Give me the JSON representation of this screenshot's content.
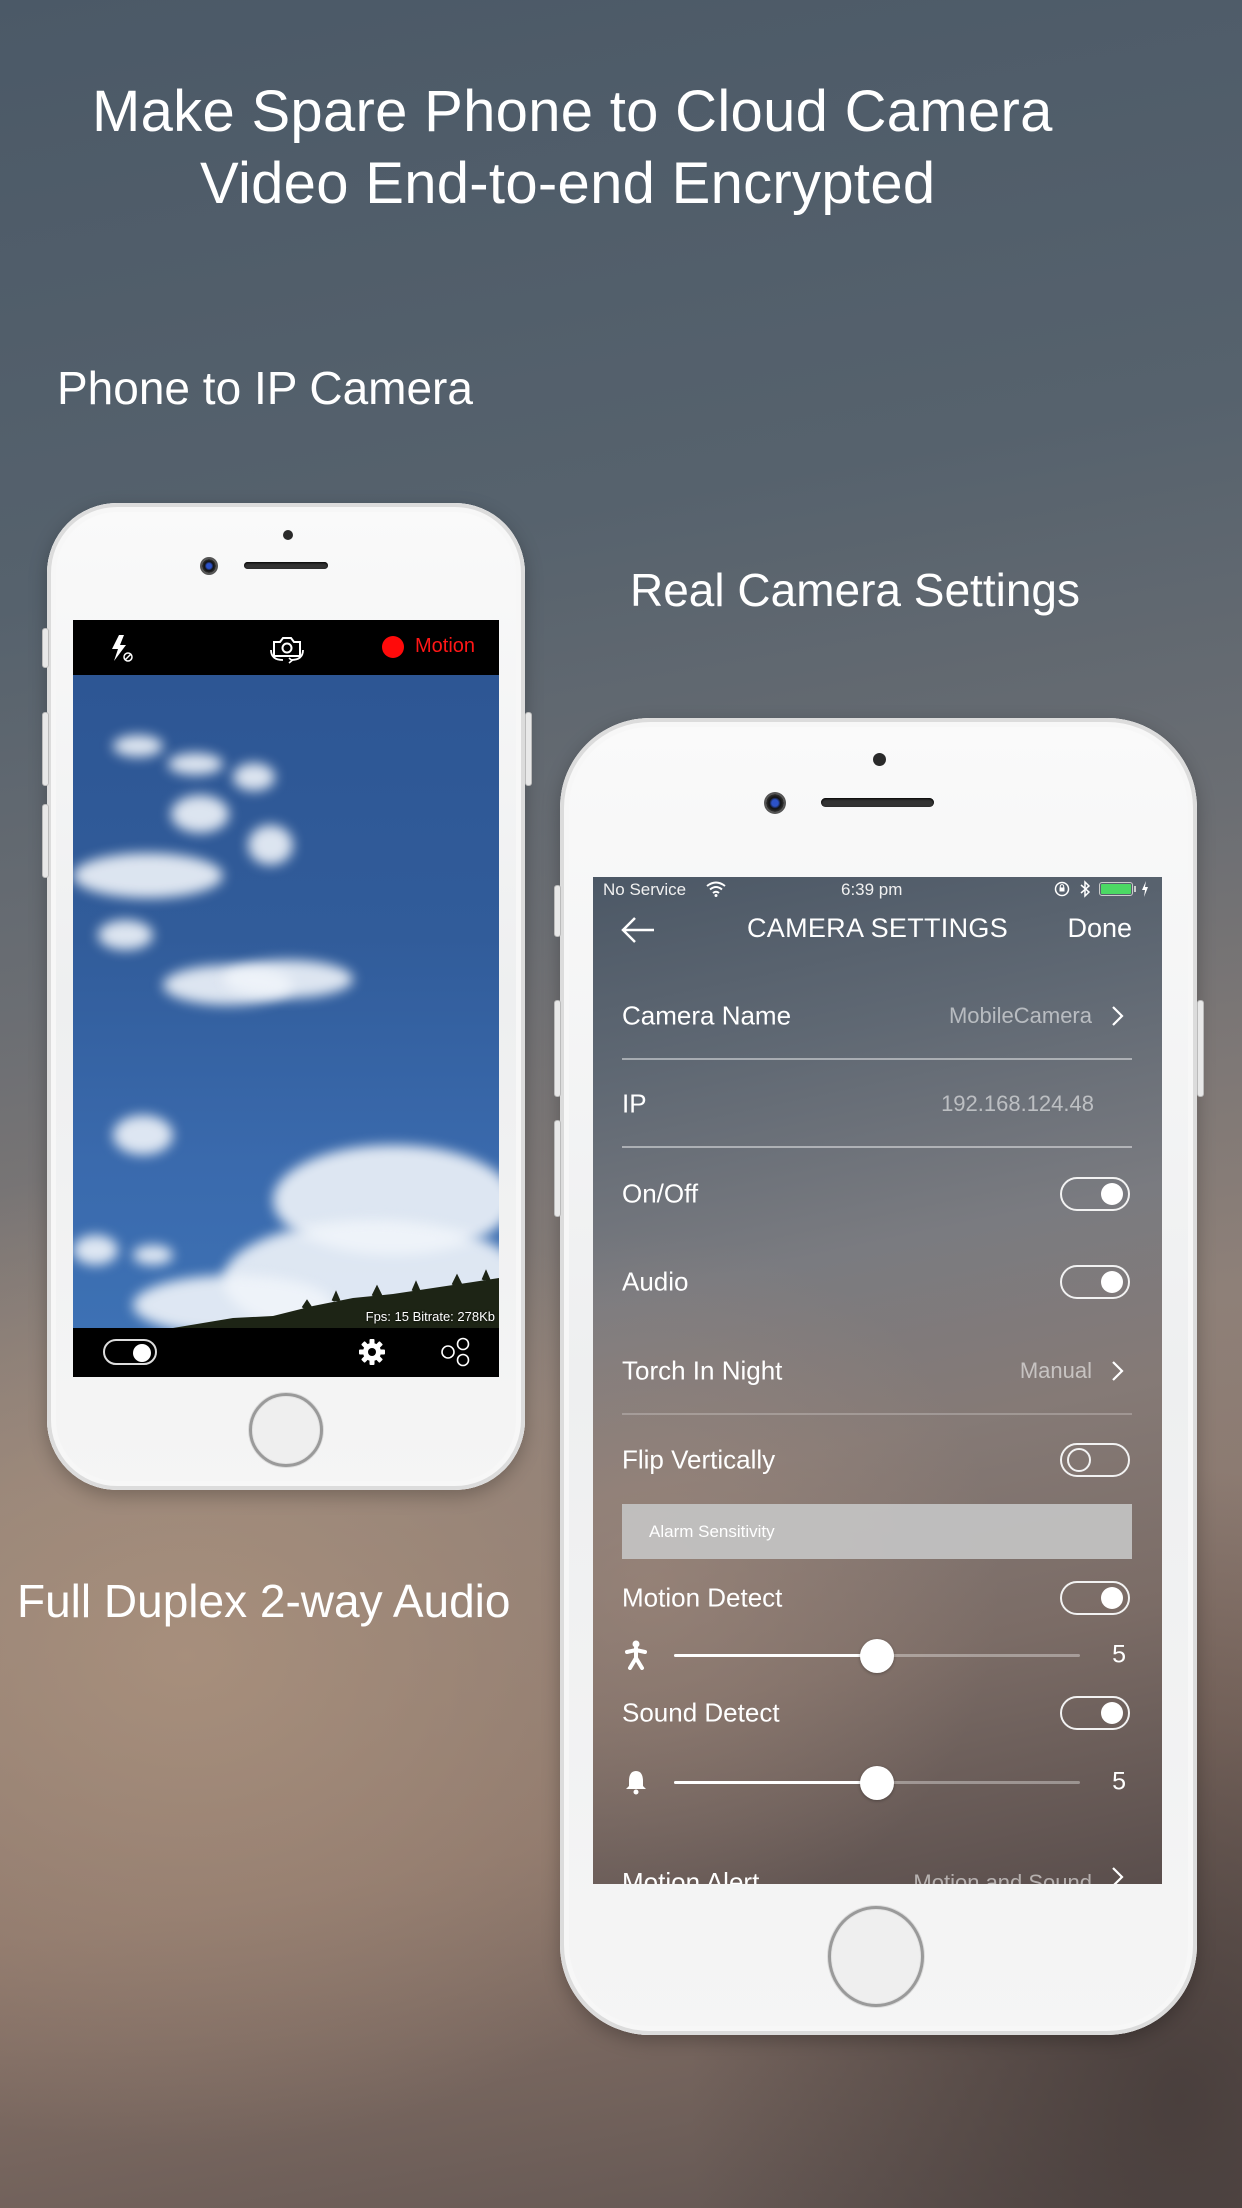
{
  "headline": {
    "line1": "Make Spare Phone to Cloud Camera",
    "line2": "Video End-to-end Encrypted"
  },
  "captions": {
    "phone_to_ip": "Phone to IP Camera",
    "real_settings": "Real Camera Settings",
    "full_duplex": "Full Duplex 2-way Audio"
  },
  "left_phone": {
    "top_bar": {
      "flash_icon": "flash-auto-off-icon",
      "switch_camera_icon": "switch-camera-icon",
      "motion_indicator_color": "#ff0a0a",
      "motion_label": "Motion"
    },
    "preview": {
      "stats": "Fps: 15 Bitrate: 278Kb"
    },
    "bottom_bar": {
      "toggle_on": true,
      "settings_icon": "gear-icon",
      "share_icon": "share-icon"
    }
  },
  "right_phone": {
    "status_bar": {
      "carrier": "No Service",
      "time": "6:39 pm",
      "battery_color": "#4cd964"
    },
    "nav": {
      "back_icon": "arrow-left-icon",
      "title": "CAMERA SETTINGS",
      "done": "Done"
    },
    "settings": [
      {
        "label": "Camera Name",
        "value": "MobileCamera",
        "type": "link"
      },
      {
        "label": "IP",
        "value": "192.168.124.48",
        "type": "value"
      },
      {
        "label": "On/Off",
        "type": "toggle",
        "on": true
      },
      {
        "label": "Audio",
        "type": "toggle",
        "on": true
      },
      {
        "label": "Torch In Night",
        "value": "Manual",
        "type": "link"
      },
      {
        "label": "Flip Vertically",
        "type": "toggle",
        "on": false
      }
    ],
    "section_header": "Alarm Sensitivity",
    "alarm": {
      "motion_detect": {
        "label": "Motion Detect",
        "on": true,
        "level": 5,
        "min": 0,
        "max": 10,
        "icon": "walking-person-icon"
      },
      "sound_detect": {
        "label": "Sound Detect",
        "on": true,
        "level": 5,
        "min": 0,
        "max": 10,
        "icon": "bell-icon"
      }
    },
    "motion_alert": {
      "label": "Motion Alert",
      "value": "Motion and Sound"
    }
  }
}
